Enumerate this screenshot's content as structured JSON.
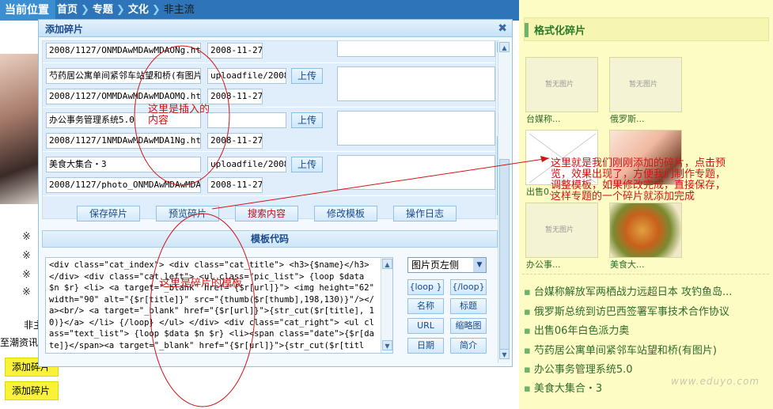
{
  "breadcrumb": {
    "label": "当前位置",
    "items": [
      "首页",
      "专题",
      "文化"
    ],
    "current": "非主流"
  },
  "left": {
    "bullets": [
      "※",
      "※",
      "※",
      "※"
    ],
    "text1": "非主",
    "text2": "至潮资讯",
    "add_buttons": [
      "添加碎片",
      "添加碎片"
    ]
  },
  "dialog": {
    "title": "添加碎片",
    "close_glyph": "✖",
    "rows": [
      {
        "title": "",
        "link": "2008/1127/ONMDAwMDAwMDAONg.html",
        "image": "",
        "date": "2008-11-27",
        "upload": ""
      },
      {
        "title": "芍药居公寓单间紧邻车站望和桥(有图片",
        "link": "2008/1127/OMMDAwMDAwMDAOMQ.html",
        "image": "uploadfile/2008/",
        "date": "2008-11-27",
        "upload": "上传"
      },
      {
        "title": "办公事务管理系统5.0",
        "link": "2008/1127/1NMDAwMDAwMDA1Ng.html",
        "image": "",
        "date": "2008-11-27",
        "upload": "上传"
      },
      {
        "title": "美食大集合・3",
        "link": "2008/1127/photo_ONMDAwMDAwMDAONQ",
        "image": "uploadfile/2008/",
        "date": "2008-11-27",
        "upload": "上传"
      }
    ],
    "actions": {
      "save": "保存碎片",
      "preview": "预览碎片",
      "search": "搜索内容",
      "edit_template": "修改模板",
      "log": "操作日志"
    },
    "template_header": "模板代码",
    "template_code": "<div class=\"cat_index\"> <div class=\"cat_title\"> <h3>{$name}</h3> </div> <div class=\"cat_left\"> <ul class=\"pic_list\"> {loop $data $n $r} <li> <a target=\"_blank\" href=\"{$r[url]}\"> <img height=\"62\" width=\"90\" alt=\"{$r[title]}\" src=\"{thumb($r[thumb],198,130)}\"/></a><br/> <a target=\"_blank\" href=\"{$r[url]}\">{str_cut($r[title], 10)}</a> </li> {/loop} </ul> </div> <div class=\"cat_right\"> <ul class=\"text_list\"> {loop $data $n $r} <li><span class=\"date\">{$r[date]}</span><a target=\"_blank\" href=\"{$r[url]}\">{str_cut($r[title], 40)}</a></li> {/loop} </ul> </div> </div>",
    "position_select": "图片页左侧",
    "insert_buttons": [
      "{loop }",
      "{/loop}",
      "名称",
      "标题",
      "URL",
      "缩略图",
      "日期",
      "简介"
    ]
  },
  "annotations": {
    "inserted": "这里是插入的\n内容",
    "template_edit": "这里是碎片的模板",
    "explain": "这里就是我们刚刚添加的碎片，点击预\n览，效果出现了，方便我们制作专题，\n调整模板，如果修改完成，直接保存，\n这样专题的一个碎片就添加完成"
  },
  "right": {
    "title": "格式化碎片",
    "placeholder": "暂无图片",
    "captions": [
      "台媒称...",
      "俄罗斯...",
      "出售0...",
      "",
      "办公事...",
      "美食大..."
    ],
    "list": [
      "台媒称解放军两栖战力远超日本 攻钓鱼岛...",
      "俄罗斯总统到访巴西签署军事技术合作协议",
      "出售06年白色派力奥",
      "芍药居公寓单间紧邻车站望和桥(有图片)",
      "办公事务管理系统5.0",
      "美食大集合・3"
    ],
    "watermark": "www.eduyo.com"
  },
  "colors": {
    "accent_blue": "#3b8fd0",
    "annotation_red": "#d21414",
    "right_panel_bg": "#fcfcc4",
    "add_button_yellow": "#f8f23a"
  }
}
